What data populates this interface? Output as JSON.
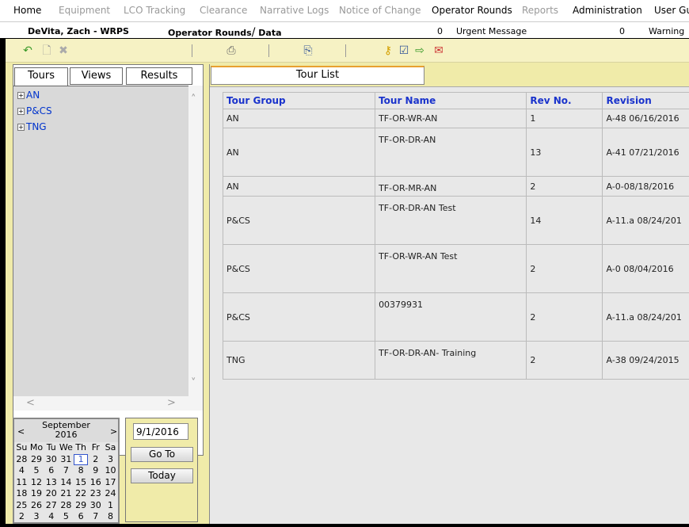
{
  "menu": {
    "items": [
      {
        "label": "Home",
        "enabled": true
      },
      {
        "label": "Equipment",
        "enabled": false
      },
      {
        "label": "LCO Tracking",
        "enabled": false
      },
      {
        "label": "Clearance",
        "enabled": false
      },
      {
        "label": "Narrative Logs",
        "enabled": false
      },
      {
        "label": "Notice of Change",
        "enabled": false
      },
      {
        "label": "Operator Rounds",
        "enabled": true
      },
      {
        "label": "Reports",
        "enabled": false
      },
      {
        "label": "Administration",
        "enabled": true
      },
      {
        "label": "User Gui",
        "enabled": true
      }
    ]
  },
  "info": {
    "user": "DeVita, Zach - WRPS",
    "breadcrumb_a": "Operator Rounds",
    "breadcrumb_sep": "/",
    "breadcrumb_b": " Data",
    "urgent_count": "0",
    "urgent_label": "Urgent Message",
    "warning_count": "0",
    "warning_label": "Warning"
  },
  "toolbar": {
    "icons": [
      "back-icon",
      "new-document-icon",
      "delete-icon",
      "print-icon",
      "copy-icon",
      "key-icon",
      "checklist-icon",
      "export-icon",
      "send-icon"
    ]
  },
  "left_tabs": {
    "tours": "Tours",
    "views": "Views",
    "results": "Results"
  },
  "tree": {
    "nodes": [
      "AN",
      "P&CS",
      "TNG"
    ]
  },
  "calendar": {
    "month": "September",
    "year": "2016",
    "prev": "<",
    "next": ">",
    "weekdays": [
      "Su",
      "Mo",
      "Tu",
      "We",
      "Th",
      "Fr",
      "Sa"
    ],
    "weeks": [
      [
        "28",
        "29",
        "30",
        "31",
        "1",
        "2",
        "3"
      ],
      [
        "4",
        "5",
        "6",
        "7",
        "8",
        "9",
        "10"
      ],
      [
        "11",
        "12",
        "13",
        "14",
        "15",
        "16",
        "17"
      ],
      [
        "18",
        "19",
        "20",
        "21",
        "22",
        "23",
        "24"
      ],
      [
        "25",
        "26",
        "27",
        "28",
        "29",
        "30",
        "1"
      ],
      [
        "2",
        "3",
        "4",
        "5",
        "6",
        "7",
        "8"
      ]
    ],
    "selected_day": "1"
  },
  "date_panel": {
    "date_value": "9/1/2016",
    "goto_label": "Go To",
    "today_label": "Today"
  },
  "right": {
    "tab_label": "Tour List"
  },
  "table": {
    "headers": [
      "Tour Group",
      "Tour Name",
      "Rev No.",
      "Revision"
    ],
    "rows": [
      [
        "AN",
        "TF-OR-WR-AN",
        "1",
        "A-48 06/16/2016"
      ],
      [
        "AN",
        "TF-OR-DR-AN",
        "13",
        "A-41 07/21/2016"
      ],
      [
        "AN",
        "TF-OR-MR-AN",
        "2",
        "A-0-08/18/2016"
      ],
      [
        "P&CS",
        "TF-OR-DR-AN Test",
        "14",
        "A-11.a 08/24/201"
      ],
      [
        "P&CS",
        "TF-OR-WR-AN Test",
        "2",
        "A-0 08/04/2016"
      ],
      [
        "P&CS",
        "00379931",
        "2",
        "A-11.a 08/24/201"
      ],
      [
        "TNG",
        "TF-OR-DR-AN- Training",
        "2",
        "A-38 09/24/2015"
      ]
    ]
  }
}
